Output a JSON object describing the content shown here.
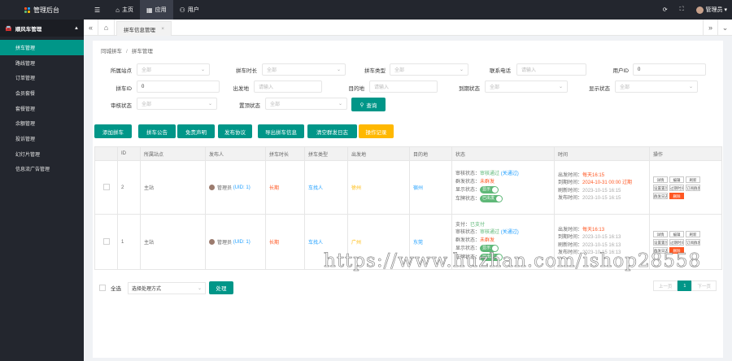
{
  "app": {
    "title": "管理后台"
  },
  "topnav": [
    {
      "icon": "☰",
      "label": ""
    },
    {
      "icon": "⌂",
      "label": "主页"
    },
    {
      "icon": "▦",
      "label": "应用"
    },
    {
      "icon": "⚇",
      "label": "用户"
    }
  ],
  "topright": {
    "refresh": "⟳",
    "fullscreen": "⛶",
    "user": "管理员",
    "caret": "▾"
  },
  "sidebar": {
    "group": "顺风车管理",
    "items": [
      "拼车管理",
      "路线管理",
      "订单管理",
      "会员套餐",
      "套餐管理",
      "余额管理",
      "投诉管理",
      "幻灯片管理",
      "信息流广告管理"
    ]
  },
  "tabs": {
    "active": "拼车信息管理",
    "close": "×"
  },
  "breadcrumb": {
    "parent": "同城拼车",
    "current": "拼车管理"
  },
  "filters": {
    "station": {
      "label": "所属站点",
      "placeholder": "全部"
    },
    "time": {
      "label": "拼车时长",
      "placeholder": "全部"
    },
    "type": {
      "label": "拼车类型",
      "placeholder": "全部"
    },
    "phone": {
      "label": "联系电话",
      "placeholder": "请输入"
    },
    "uid": {
      "label": "用户ID",
      "value": "0"
    },
    "pid": {
      "label": "拼车ID",
      "value": "0"
    },
    "from": {
      "label": "出发地",
      "placeholder": "请输入"
    },
    "to": {
      "label": "目的地",
      "placeholder": "请输入"
    },
    "arrive": {
      "label": "到期状态",
      "placeholder": "全部"
    },
    "show": {
      "label": "显示状态",
      "placeholder": "全部"
    },
    "review": {
      "label": "审核状态",
      "placeholder": "全部"
    },
    "top": {
      "label": "置顶状态",
      "placeholder": "全部"
    },
    "search": "查询"
  },
  "actions": [
    "添加拼车",
    "拼车公告",
    "免责声明",
    "发布协议",
    "导出拼车信息",
    "清空群发日志",
    "操作记录"
  ],
  "table": {
    "headers": [
      "",
      "ID",
      "所属站点",
      "发布人",
      "拼车时长",
      "拼车类型",
      "出发地",
      "目的地",
      "状态",
      "时间",
      "操作"
    ],
    "rows": [
      {
        "id": "2",
        "station": "主站",
        "publisher": "管理员",
        "uid": "(UID: 1)",
        "duration": "长期",
        "type": "车找人",
        "from": "徐州",
        "to": "宿州",
        "status": [
          [
            "审核状态：",
            "审核通过",
            "(关通过)"
          ],
          [
            "群发状态：",
            "未群发",
            ""
          ],
          [
            "显示状态：",
            "显示",
            ""
          ],
          [
            "车牌状态：",
            "已出发",
            ""
          ]
        ],
        "times": [
          [
            "出发时间：",
            "每天16:15"
          ],
          [
            "到期时间：",
            "2024-10-31 00:00 过期"
          ],
          [
            "刷新时间：",
            "2023-10-15 16:15"
          ],
          [
            "发布时间：",
            "2023-10-15 16:15"
          ]
        ],
        "ops": [
          "详情",
          "编辑",
          "刷新",
          "设置置顶",
          "过期时间",
          "订阅群发",
          "群发日志",
          "删除"
        ]
      },
      {
        "id": "1",
        "station": "主站",
        "publisher": "管理员",
        "uid": "(UID: 1)",
        "duration": "长期",
        "type": "车找人",
        "from": "广州",
        "to": "东莞",
        "status": [
          [
            "支付：",
            "已支付",
            ""
          ],
          [
            "审核状态：",
            "审核通过",
            "(关通过)"
          ],
          [
            "群发状态：",
            "未群发",
            ""
          ],
          [
            "显示状态：",
            "显示",
            ""
          ],
          [
            "车牌状态：",
            "已出发",
            ""
          ]
        ],
        "times": [
          [
            "出发时间：",
            "每天16:13"
          ],
          [
            "到期时间：",
            "2023-10-15 16:13"
          ],
          [
            "刷新时间：",
            "2023-10-15 16:13"
          ],
          [
            "发布时间：",
            "2023-10-15 16:13"
          ]
        ],
        "ops": [
          "详情",
          "编辑",
          "刷新",
          "设置置顶",
          "过期时间",
          "订阅群发",
          "群发日志",
          "删除"
        ]
      }
    ]
  },
  "bottom": {
    "selectAll": "全选",
    "batchPlaceholder": "选择处理方式",
    "process": "处理"
  },
  "pager": {
    "prev": "上一页",
    "page": "1",
    "next": "下一页"
  },
  "watermark": "https://www.huzhan.com/ishop28558",
  "colors": {
    "primary": "#009688",
    "warning": "#ffb800",
    "danger": "#ff5722",
    "dark": "#23262e"
  }
}
